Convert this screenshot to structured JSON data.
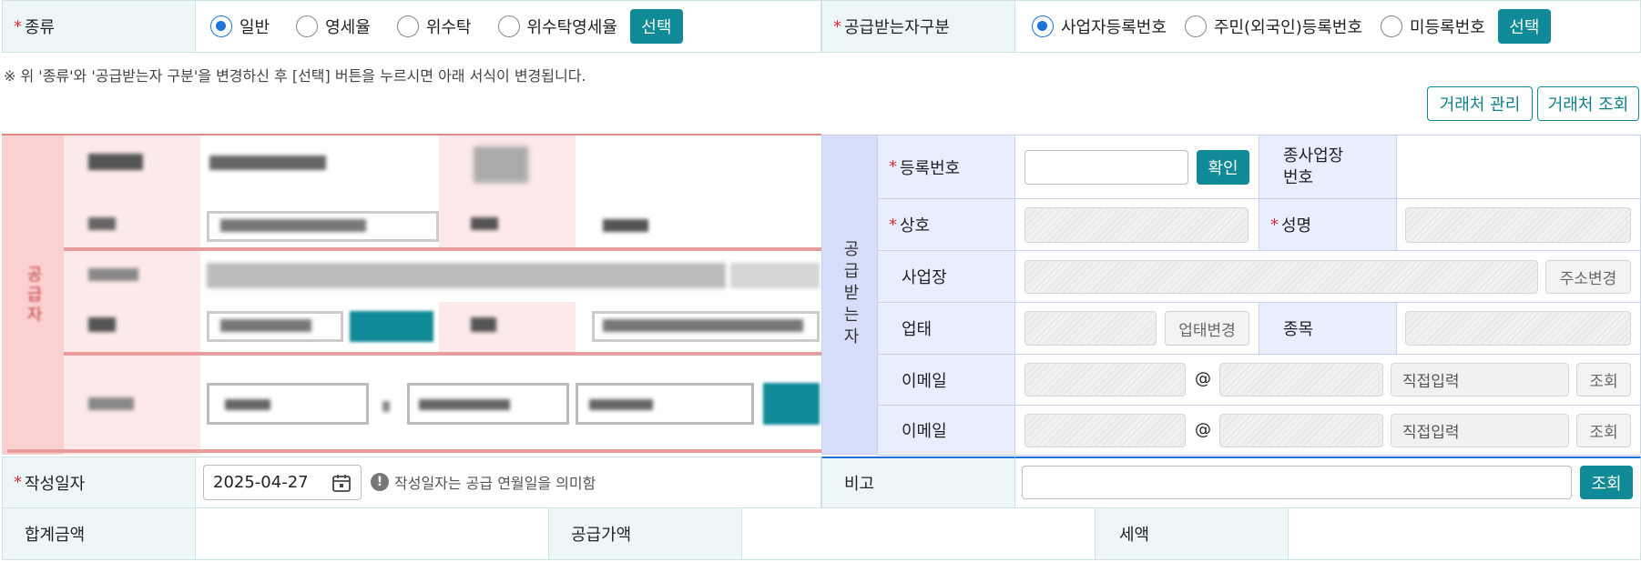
{
  "top": {
    "type_label": "종류",
    "type_options": [
      {
        "label": "일반",
        "selected": true
      },
      {
        "label": "영세율",
        "selected": false
      },
      {
        "label": "위수탁",
        "selected": false
      },
      {
        "label": "위수탁영세율",
        "selected": false
      }
    ],
    "type_select_btn": "선택",
    "recv_label": "공급받는자구분",
    "recv_options": [
      {
        "label": "사업자등록번호",
        "selected": true
      },
      {
        "label": "주민(외국인)등록번호",
        "selected": false
      },
      {
        "label": "미등록번호",
        "selected": false
      }
    ],
    "recv_select_btn": "선택"
  },
  "notice": "※ 위 '종류'와 '공급받는자 구분'을 변경하신 후 [선택] 버튼을 누르시면 아래 서식이 변경됩니다.",
  "buttons": {
    "client_manage": "거래처 관리",
    "client_search": "거래처 조회"
  },
  "supplier": {
    "side_label": "공급자"
  },
  "receiver": {
    "side_label": "공급받는자",
    "reg_no_label": "등록번호",
    "confirm_btn": "확인",
    "branch_no_label": "종사업장\n번호",
    "company_label": "상호",
    "name_label": "성명",
    "workplace_label": "사업장",
    "addr_change_btn": "주소변경",
    "biz_type_label": "업태",
    "biz_type_change_btn": "업태변경",
    "item_label": "종목",
    "email_label_1": "이메일",
    "email_label_2": "이메일",
    "at": "@",
    "direct_input": "직접입력",
    "lookup_btn": "조회"
  },
  "footer": {
    "date_label": "작성일자",
    "date_value": "2025-04-27",
    "date_hint": "작성일자는 공급 연월일을 의미함",
    "note_label": "비고",
    "note_btn": "조회",
    "total_label": "합계금액",
    "supply_label": "공급가액",
    "tax_label": "세액"
  },
  "colors": {
    "teal": "#0f8a96",
    "supplier_bg": "#fde9e9",
    "receiver_bg": "#e9eefe",
    "required": "#e0283c"
  }
}
